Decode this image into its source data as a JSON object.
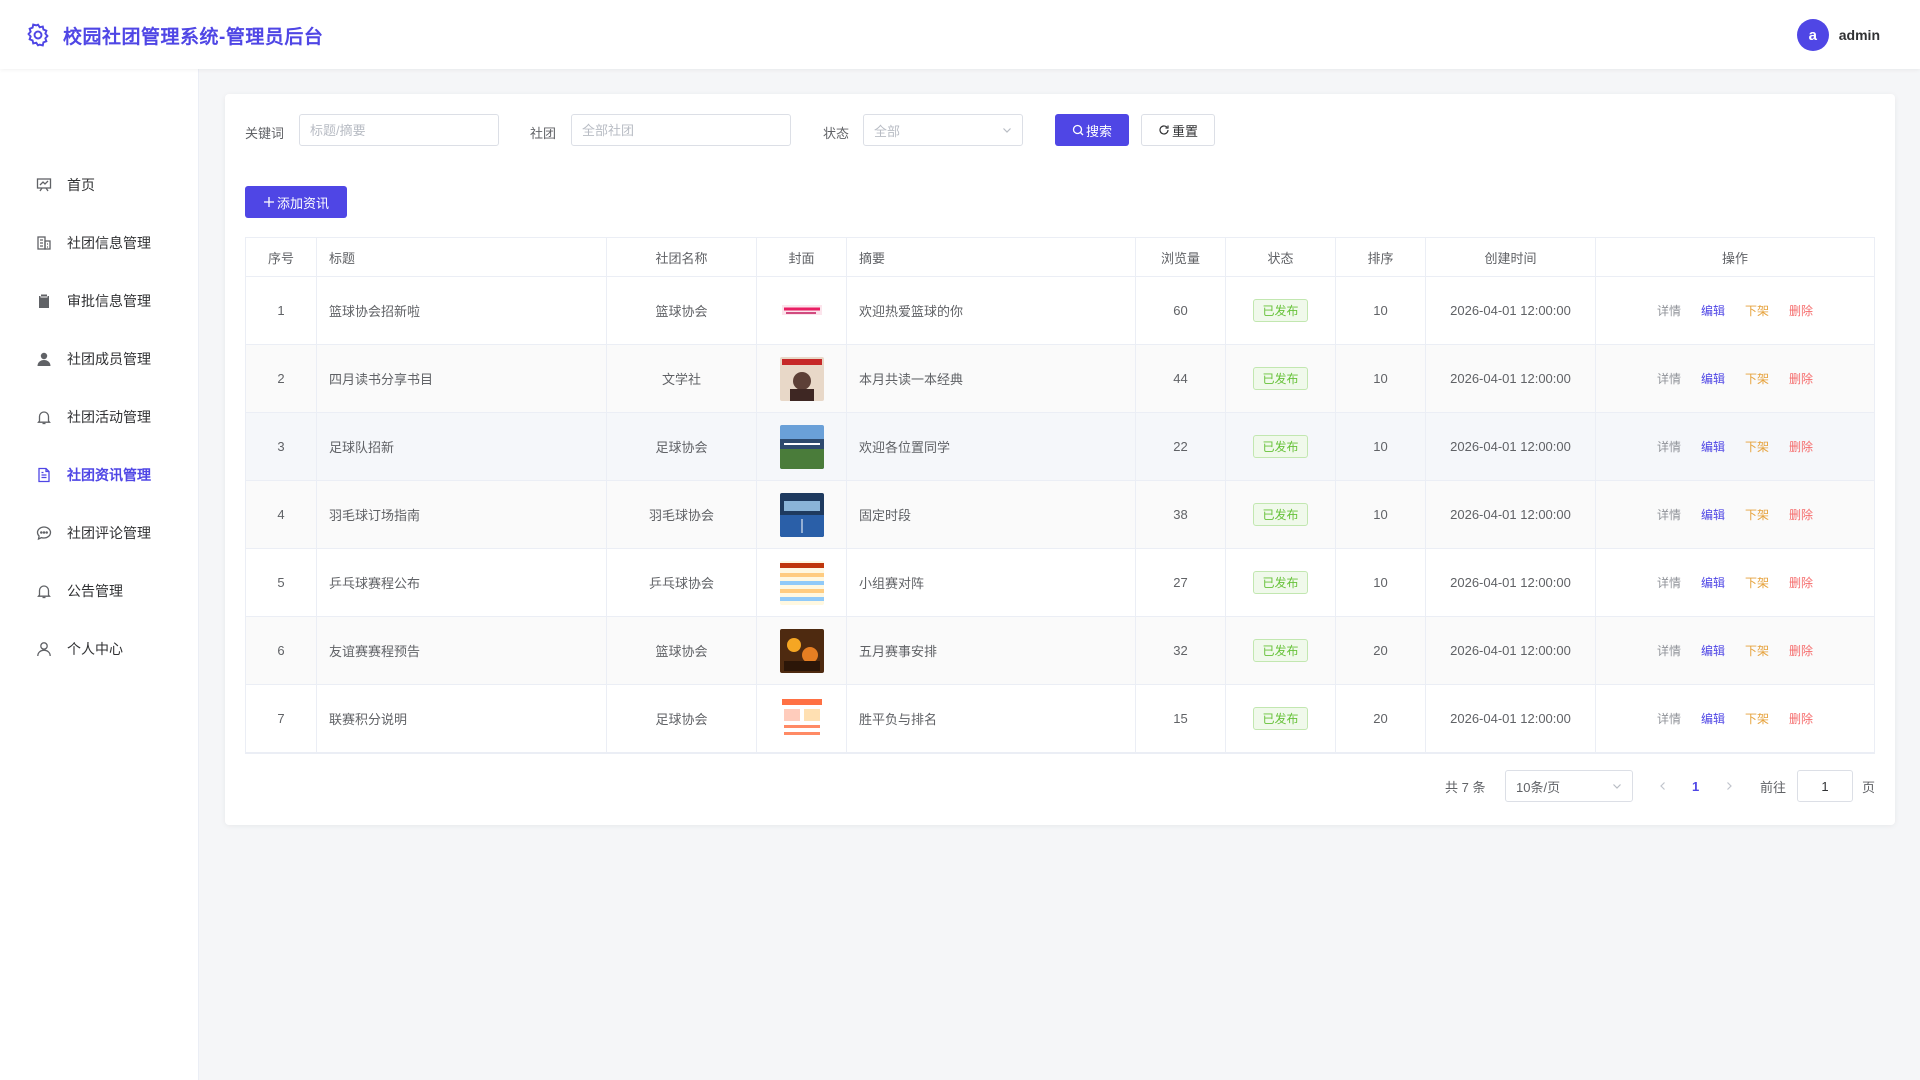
{
  "header": {
    "title": "校园社团管理系统-管理员后台",
    "user_initial": "a",
    "username": "admin"
  },
  "sidebar": {
    "items": [
      {
        "label": "首页",
        "icon": "chart-board-icon"
      },
      {
        "label": "社团信息管理",
        "icon": "building-icon"
      },
      {
        "label": "审批信息管理",
        "icon": "clipboard-icon"
      },
      {
        "label": "社团成员管理",
        "icon": "user-filled-icon"
      },
      {
        "label": "社团活动管理",
        "icon": "bell-icon"
      },
      {
        "label": "社团资讯管理",
        "icon": "document-icon",
        "active": true
      },
      {
        "label": "社团评论管理",
        "icon": "chat-dot-icon"
      },
      {
        "label": "公告管理",
        "icon": "bell-icon"
      },
      {
        "label": "个人中心",
        "icon": "user-icon"
      }
    ]
  },
  "filters": {
    "keyword_label": "关键词",
    "keyword_placeholder": "标题/摘要",
    "club_label": "社团",
    "club_placeholder": "全部社团",
    "status_label": "状态",
    "status_value": "全部",
    "search_label": "搜索",
    "reset_label": "重置"
  },
  "add_button_label": "添加资讯",
  "table": {
    "columns": [
      "序号",
      "标题",
      "社团名称",
      "封面",
      "摘要",
      "浏览量",
      "状态",
      "排序",
      "创建时间",
      "操作"
    ],
    "ops": {
      "detail": "详情",
      "edit": "编辑",
      "off": "下架",
      "delete": "删除"
    },
    "rows": [
      {
        "no": "1",
        "title": "篮球协会招新啦",
        "club": "篮球协会",
        "summary": "欢迎热爱篮球的你",
        "views": "60",
        "status": "已发布",
        "sort": "10",
        "created": "2026-04-01 12:00:00"
      },
      {
        "no": "2",
        "title": "四月读书分享书目",
        "club": "文学社",
        "summary": "本月共读一本经典",
        "views": "44",
        "status": "已发布",
        "sort": "10",
        "created": "2026-04-01 12:00:00"
      },
      {
        "no": "3",
        "title": "足球队招新",
        "club": "足球协会",
        "summary": "欢迎各位置同学",
        "views": "22",
        "status": "已发布",
        "sort": "10",
        "created": "2026-04-01 12:00:00"
      },
      {
        "no": "4",
        "title": "羽毛球订场指南",
        "club": "羽毛球协会",
        "summary": "固定时段",
        "views": "38",
        "status": "已发布",
        "sort": "10",
        "created": "2026-04-01 12:00:00"
      },
      {
        "no": "5",
        "title": "乒乓球赛程公布",
        "club": "乒乓球协会",
        "summary": "小组赛对阵",
        "views": "27",
        "status": "已发布",
        "sort": "10",
        "created": "2026-04-01 12:00:00"
      },
      {
        "no": "6",
        "title": "友谊赛赛程预告",
        "club": "篮球协会",
        "summary": "五月赛事安排",
        "views": "32",
        "status": "已发布",
        "sort": "20",
        "created": "2026-04-01 12:00:00"
      },
      {
        "no": "7",
        "title": "联赛积分说明",
        "club": "足球协会",
        "summary": "胜平负与排名",
        "views": "15",
        "status": "已发布",
        "sort": "20",
        "created": "2026-04-01 12:00:00"
      }
    ]
  },
  "pagination": {
    "total_text": "共 7 条",
    "page_size": "10条/页",
    "current_page": "1",
    "goto_label": "前往",
    "goto_value": "1",
    "page_suffix": "页"
  }
}
